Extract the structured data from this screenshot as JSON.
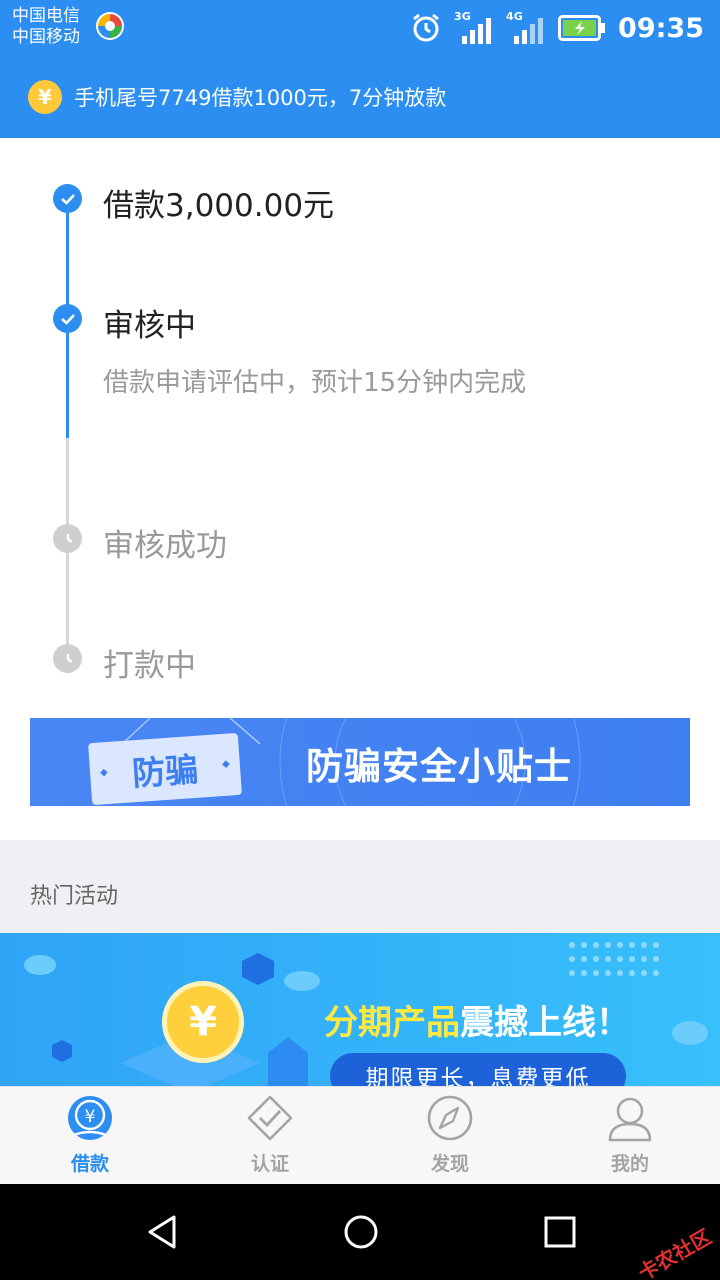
{
  "status_bar": {
    "carrier_1": "中国电信",
    "carrier_2": "中国移动",
    "network_1": "3G",
    "network_2": "4G",
    "time": "09:35"
  },
  "notice": {
    "icon": "yen-icon",
    "text": "手机尾号7749借款1000元，7分钟放款"
  },
  "progress": {
    "steps": [
      {
        "title": "借款3,000.00元",
        "state": "done"
      },
      {
        "title": "审核中",
        "desc": "借款申请评估中，预计15分钟内完成",
        "state": "done"
      },
      {
        "title": "审核成功",
        "state": "pending"
      },
      {
        "title": "打款中",
        "state": "pending"
      }
    ]
  },
  "fraud_banner": {
    "tag": "防骗",
    "title": "防骗安全小贴士"
  },
  "section": {
    "title": "热门活动"
  },
  "promo": {
    "coin_symbol": "¥",
    "title_highlight": "分期产品",
    "title_rest": "震撼上线！",
    "subtitle": "期限更长，息费更低"
  },
  "tabbar": {
    "items": [
      {
        "label": "借款",
        "icon": "loan-yen-icon",
        "active": true
      },
      {
        "label": "认证",
        "icon": "verify-icon",
        "active": false
      },
      {
        "label": "发现",
        "icon": "compass-icon",
        "active": false
      },
      {
        "label": "我的",
        "icon": "user-icon",
        "active": false
      }
    ]
  },
  "watermark": "卡农社区",
  "colors": {
    "primary": "#2b8ef0",
    "pending": "#cfcfcf",
    "coin": "#ffc93a"
  }
}
